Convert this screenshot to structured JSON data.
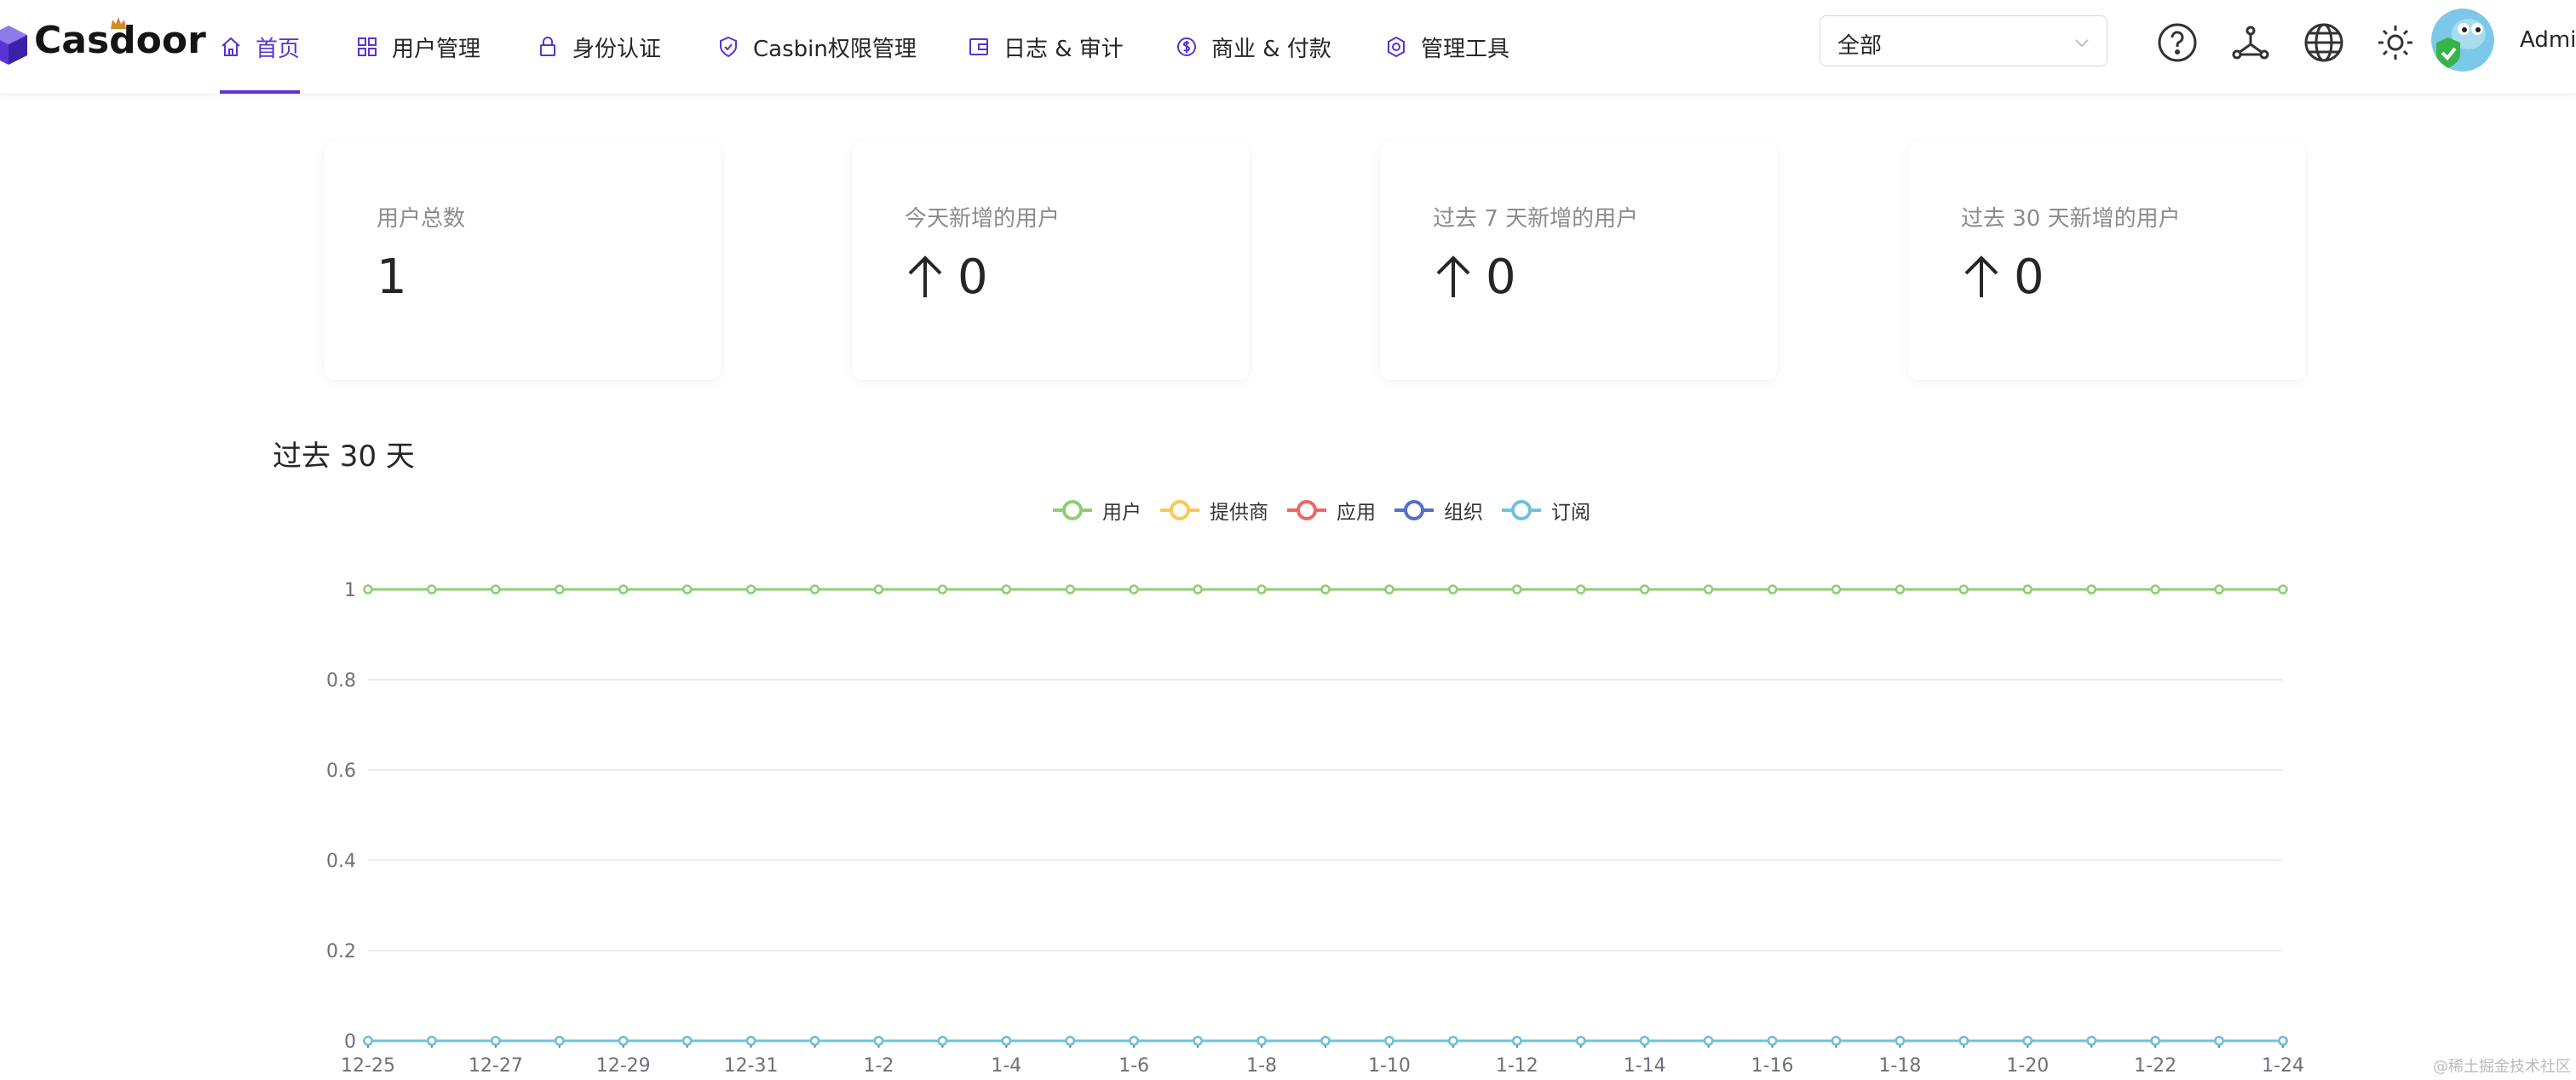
{
  "app": {
    "logo_text": "Casdoor"
  },
  "nav": {
    "items": [
      {
        "label": "首页",
        "icon": "home-icon",
        "active": true
      },
      {
        "label": "用户管理",
        "icon": "grid-icon",
        "active": false
      },
      {
        "label": "身份认证",
        "icon": "lock-icon",
        "active": false
      },
      {
        "label": "Casbin权限管理",
        "icon": "shield-check-icon",
        "active": false
      },
      {
        "label": "日志 & 审计",
        "icon": "wallet-icon",
        "active": false
      },
      {
        "label": "商业 & 付款",
        "icon": "dollar-icon",
        "active": false
      },
      {
        "label": "管理工具",
        "icon": "gear-icon",
        "active": false
      }
    ]
  },
  "header": {
    "org_select": {
      "value": "全部"
    },
    "icons": [
      "help-icon",
      "tour-icon",
      "language-icon",
      "theme-icon"
    ],
    "user_name": "Admin"
  },
  "stats": [
    {
      "title": "用户总数",
      "value": "1",
      "arrow": false
    },
    {
      "title": "今天新增的用户",
      "value": "0",
      "arrow": true
    },
    {
      "title": "过去 7 天新增的用户",
      "value": "0",
      "arrow": true
    },
    {
      "title": "过去 30 天新增的用户",
      "value": "0",
      "arrow": true
    }
  ],
  "colors": {
    "accent": "#5734d3"
  },
  "chart_data": {
    "type": "line",
    "title": "过去 30 天",
    "legend_position": "top-center",
    "grid": true,
    "ylim": [
      0,
      1
    ],
    "y_ticks": [
      "0",
      "0.2",
      "0.4",
      "0.6",
      "0.8",
      "1"
    ],
    "x": [
      "12-25",
      "12-26",
      "12-27",
      "12-28",
      "12-29",
      "12-30",
      "12-31",
      "1-1",
      "1-2",
      "1-3",
      "1-4",
      "1-5",
      "1-6",
      "1-7",
      "1-8",
      "1-9",
      "1-10",
      "1-11",
      "1-12",
      "1-13",
      "1-14",
      "1-15",
      "1-16",
      "1-17",
      "1-18",
      "1-19",
      "1-20",
      "1-21",
      "1-22",
      "1-23",
      "1-24"
    ],
    "x_tick_labels": [
      "12-25",
      "12-27",
      "12-29",
      "12-31",
      "1-2",
      "1-4",
      "1-6",
      "1-8",
      "1-10",
      "1-12",
      "1-14",
      "1-16",
      "1-18",
      "1-20",
      "1-22",
      "1-24"
    ],
    "series": [
      {
        "name": "用户",
        "color": "#91cc75",
        "values": [
          1,
          1,
          1,
          1,
          1,
          1,
          1,
          1,
          1,
          1,
          1,
          1,
          1,
          1,
          1,
          1,
          1,
          1,
          1,
          1,
          1,
          1,
          1,
          1,
          1,
          1,
          1,
          1,
          1,
          1,
          1
        ]
      },
      {
        "name": "提供商",
        "color": "#fac858",
        "values": [
          0,
          0,
          0,
          0,
          0,
          0,
          0,
          0,
          0,
          0,
          0,
          0,
          0,
          0,
          0,
          0,
          0,
          0,
          0,
          0,
          0,
          0,
          0,
          0,
          0,
          0,
          0,
          0,
          0,
          0,
          0
        ]
      },
      {
        "name": "应用",
        "color": "#ee6666",
        "values": [
          0,
          0,
          0,
          0,
          0,
          0,
          0,
          0,
          0,
          0,
          0,
          0,
          0,
          0,
          0,
          0,
          0,
          0,
          0,
          0,
          0,
          0,
          0,
          0,
          0,
          0,
          0,
          0,
          0,
          0,
          0
        ]
      },
      {
        "name": "组织",
        "color": "#5470c6",
        "values": [
          0,
          0,
          0,
          0,
          0,
          0,
          0,
          0,
          0,
          0,
          0,
          0,
          0,
          0,
          0,
          0,
          0,
          0,
          0,
          0,
          0,
          0,
          0,
          0,
          0,
          0,
          0,
          0,
          0,
          0,
          0
        ]
      },
      {
        "name": "订阅",
        "color": "#73c0de",
        "values": [
          0,
          0,
          0,
          0,
          0,
          0,
          0,
          0,
          0,
          0,
          0,
          0,
          0,
          0,
          0,
          0,
          0,
          0,
          0,
          0,
          0,
          0,
          0,
          0,
          0,
          0,
          0,
          0,
          0,
          0,
          0
        ]
      }
    ]
  },
  "watermark": "@稀土掘金技术社区"
}
